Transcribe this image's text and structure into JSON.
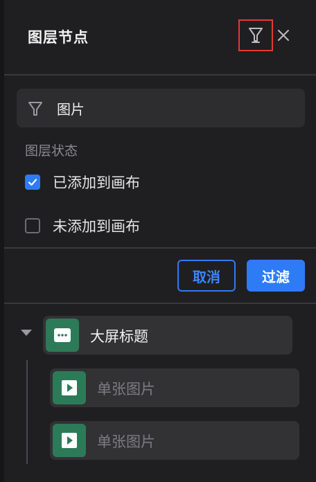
{
  "header": {
    "title": "图层节点",
    "filter_icon": "filter-funnel-icon",
    "close_icon": "close-icon",
    "filter_highlight_color": "#e53b33"
  },
  "filter": {
    "search_icon": "filter-funnel-icon",
    "search_value": "图片",
    "section_label": "图层状态",
    "options": [
      {
        "label": "已添加到画布",
        "checked": true
      },
      {
        "label": "未添加到画布",
        "checked": false
      }
    ],
    "cancel_label": "取消",
    "apply_label": "过滤",
    "accent_color": "#2e7bf6"
  },
  "tree": {
    "parent": {
      "label": "大屏标题",
      "icon": "text-component-icon",
      "expanded": true
    },
    "children": [
      {
        "label": "单张图片",
        "icon": "image-play-icon"
      },
      {
        "label": "单张图片",
        "icon": "image-play-icon"
      }
    ],
    "node_icon_color": "#2d7a58"
  }
}
